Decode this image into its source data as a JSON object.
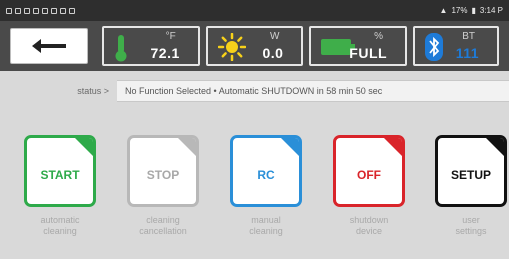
{
  "statusbar": {
    "right_text": "17%",
    "time": "3:14 P"
  },
  "widgets": {
    "temperature": {
      "unit": "°F",
      "value": "72.1"
    },
    "light": {
      "unit": "W",
      "value": "0.0"
    },
    "battery": {
      "unit": "%",
      "value": "FULL"
    },
    "bluetooth": {
      "unit": "BT",
      "value": "111"
    }
  },
  "status": {
    "label": "status >",
    "text": "No Function Selected • Automatic SHUTDOWN in 58 min 50 sec"
  },
  "functions": [
    {
      "label": "START",
      "desc_line1": "automatic",
      "desc_line2": "cleaning",
      "color": "#2eaa4a"
    },
    {
      "label": "STOP",
      "desc_line1": "cleaning",
      "desc_line2": "cancellation",
      "color": "#b8b8b8"
    },
    {
      "label": "RC",
      "desc_line1": "manual",
      "desc_line2": "cleaning",
      "color": "#2a8fd8"
    },
    {
      "label": "OFF",
      "desc_line1": "shutdown",
      "desc_line2": "device",
      "color": "#d9242a"
    },
    {
      "label": "SETUP",
      "desc_line1": "user",
      "desc_line2": "settings",
      "color": "#111111"
    }
  ]
}
